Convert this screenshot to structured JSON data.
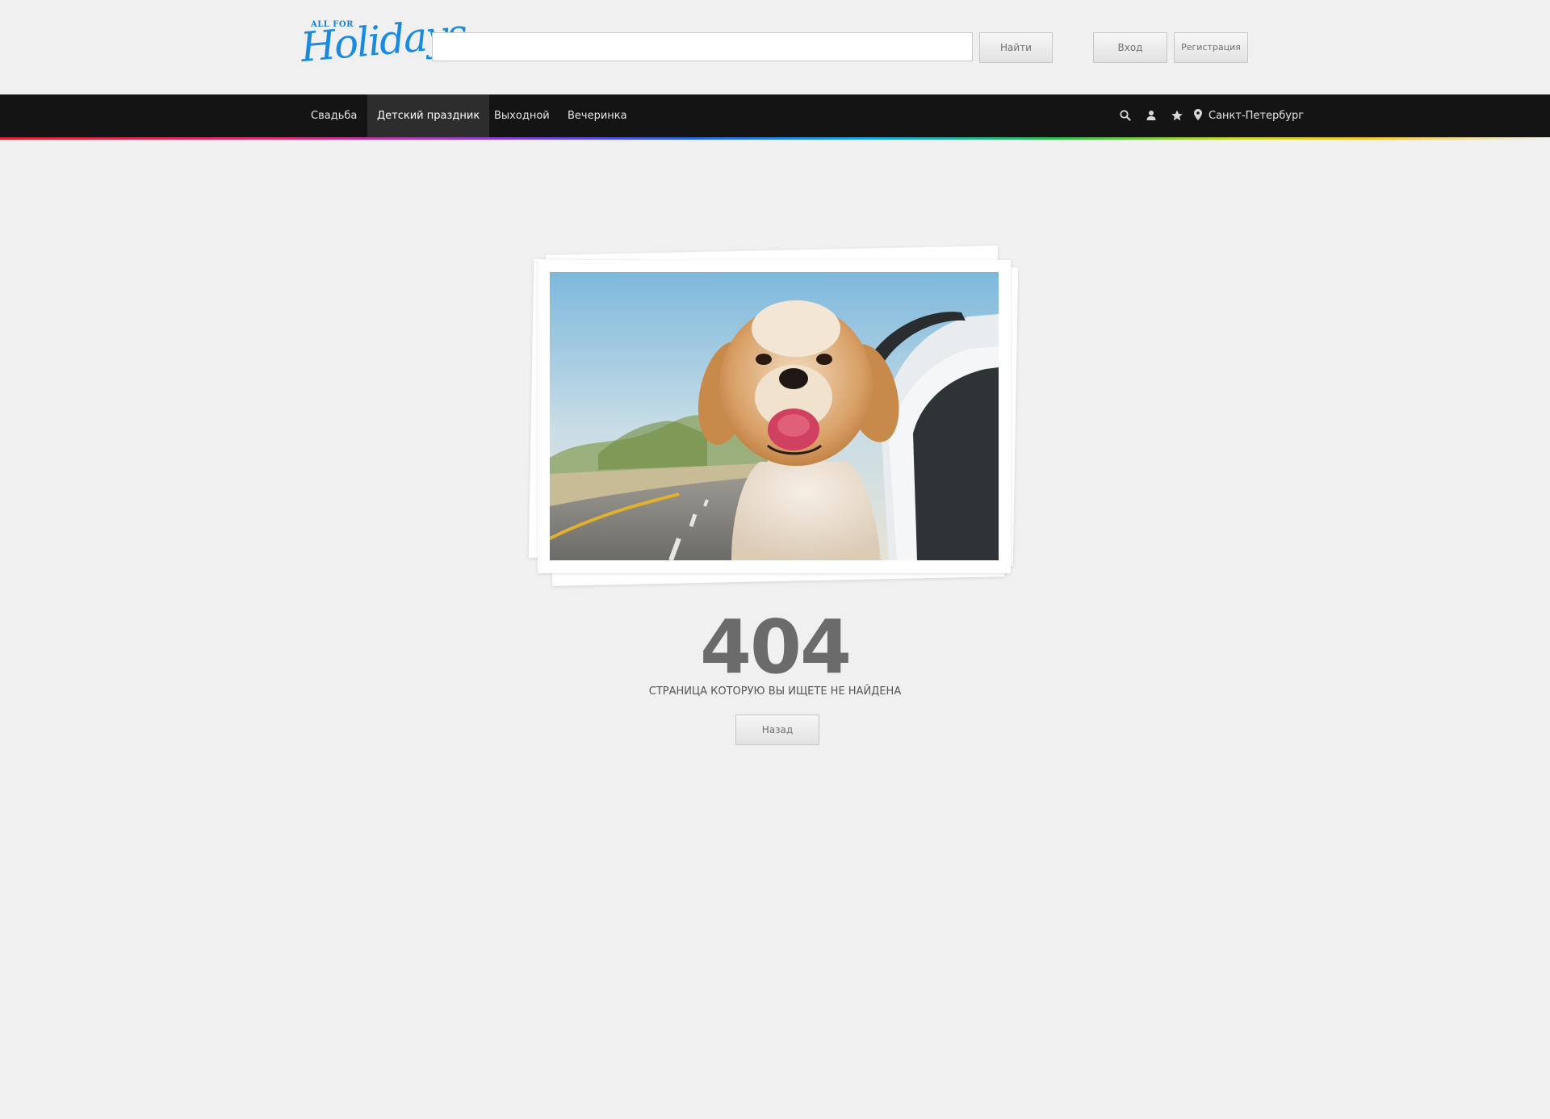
{
  "header": {
    "logo": {
      "small_text": "ALL FOR",
      "big_text": "Holidays"
    },
    "search": {
      "value": "",
      "placeholder": ""
    },
    "find_button": "Найти",
    "login_button": "Вход",
    "register_button": "Регистрация"
  },
  "nav": {
    "items": [
      {
        "label": "Свадьба",
        "active": false
      },
      {
        "label": "Детский праздник",
        "active": true
      },
      {
        "label": "Выходной",
        "active": false
      },
      {
        "label": "Вечеринка",
        "active": false
      }
    ],
    "icons": [
      "search-icon",
      "user-icon",
      "star-icon",
      "location-pin-icon"
    ],
    "city": "Санкт-Петербург"
  },
  "error": {
    "code": "404",
    "message": "СТРАНИЦА КОТОРУЮ ВЫ ИЩЕТЕ НЕ НАЙДЕНА",
    "back_button": "Назад"
  },
  "colors": {
    "page_background": "#f0f0f0",
    "navbar": "#141414",
    "navbar_active": "#2d2d2d",
    "logo_blue": "#1a8ae0",
    "error_code": "#6b6b6b"
  }
}
